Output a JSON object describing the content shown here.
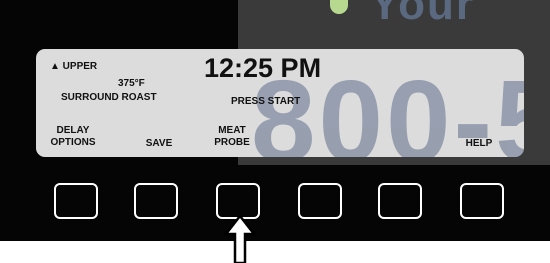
{
  "display": {
    "oven": "▲ UPPER",
    "temperature": "375°F",
    "mode": "SURROUND ROAST",
    "time": "12:25 PM",
    "prompt": "PRESS START"
  },
  "softkeys": {
    "key1_line1": "DELAY",
    "key1_line2": "OPTIONS",
    "key2": "SAVE",
    "key3_line1": "MEAT",
    "key3_line2": "PROBE",
    "key6": "HELP"
  },
  "watermark": {
    "top_text": "Your",
    "big_text": "800-5"
  },
  "colors": {
    "panel": "#050505",
    "lcd": "#dcdcdc",
    "key_border": "#ffffff"
  },
  "icons": {
    "pointer": "up-arrow"
  }
}
